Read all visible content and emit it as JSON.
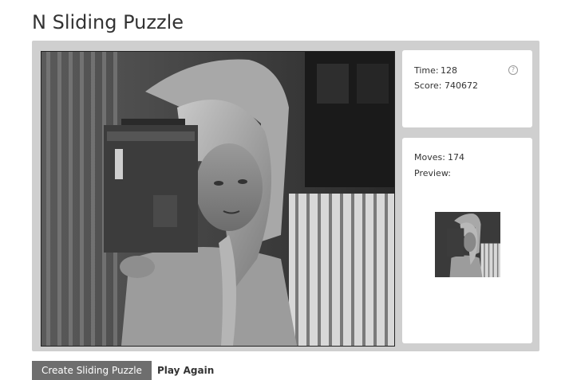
{
  "page": {
    "title": "N Sliding Puzzle"
  },
  "stats": {
    "time_label": "Time:",
    "time_value": "128",
    "score_label": "Score:",
    "score_value": "740672",
    "moves_label": "Moves:",
    "moves_value": "174",
    "preview_label": "Preview:",
    "help_glyph": "?"
  },
  "buttons": {
    "create_label": "Create Sliding Puzzle",
    "again_label": "Play Again"
  },
  "colors": {
    "board_bg": "#cfcfcf",
    "panel_bg": "#ffffff",
    "create_btn_bg": "#6e6e6e"
  }
}
